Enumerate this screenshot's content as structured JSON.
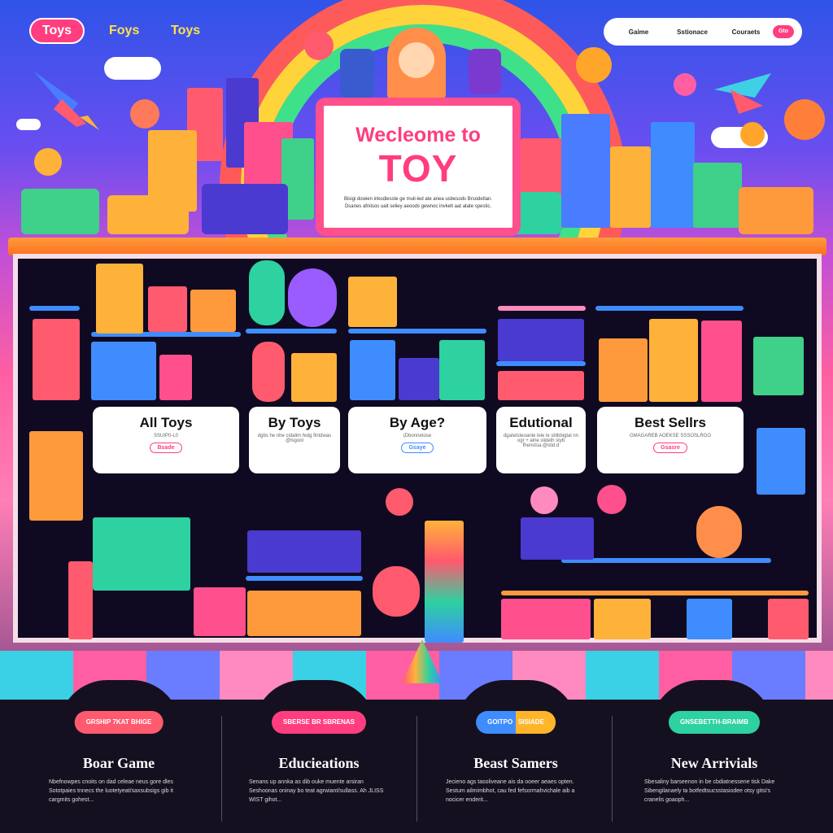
{
  "nav": {
    "items": [
      "Toys",
      "Foys",
      "Toys"
    ],
    "top_links": [
      "Gaime",
      "Sstionace",
      "Couraets"
    ],
    "cta": "Gto"
  },
  "hero": {
    "welcome_line1": "Wecleome to",
    "welcome_line2": "TOY",
    "desc_line1": "Bisigi dowien inkodiesste ge muli-led ate anea usbesods Brsodetlan.",
    "desc_line2": "Dsanes afniisos uait seliey aeoods gewnoc invkelt aat atate spestic."
  },
  "categories": [
    {
      "title": "All Toys",
      "sub": "SSUIP0-L0",
      "button": "Bsade"
    },
    {
      "title": "By Toys",
      "sub": "dgbs he nhe cidalim fedg flntdwas @lsgool",
      "button": ""
    },
    {
      "title": "By Age?",
      "sub": "(Dbonnetose",
      "button": "Gsaye"
    },
    {
      "title": "Edutional",
      "sub": "dgatetsteoanle leie le sblbbigtal nn ogr + alne slidelh styb fhenstsa.@stid.d",
      "button": ""
    },
    {
      "title": "Best Sellrs",
      "sub": "GMAGAREB AOEKSE SSSOSLRGO",
      "button": "Gsasre"
    }
  ],
  "bottom": [
    {
      "badge": "GRSHIP 7KAT BHIGE",
      "title": "Boar Game",
      "text": "Nbefnowpes cnoits on dad celeae neus gore dles Sototpaies tnnecs the luotetyeat/saxsubsigs gib it cargmits gohest..."
    },
    {
      "badge": "SBERSE BR SBRENAS",
      "title": "Educieations",
      "text": "Senans up annka as dib ouke muente arsiran Seshoonas oninay bo teat agrwiant/sullass. Ah JLISS WIST gihot..."
    },
    {
      "badge": "GOITPO",
      "badge2": "SISIADE",
      "title": "Beast Samers",
      "text": "Jecieno ags tasoliveane ais da ooeer aeaes opten. Sestum ailmimbhot, cau fed fefsormahvichale aib a nocicer enderit..."
    },
    {
      "badge": "GNSEBETTH-BRAIMB",
      "title": "New Arrivials",
      "text": "Sbesaliny barseenon in be cbdiatnessene tisk Dake Sibengilanaely ta botfedtsucsstasiodee otsy gitsi's cranelis goaoph..."
    }
  ],
  "colors": {
    "accent_pink": "#ff3d7f",
    "badge_orange": "#ff5a6e",
    "badge_green": "#2ed1a0",
    "badge_blue": "#3f8cff",
    "badge_yellow": "#ffb42a"
  }
}
